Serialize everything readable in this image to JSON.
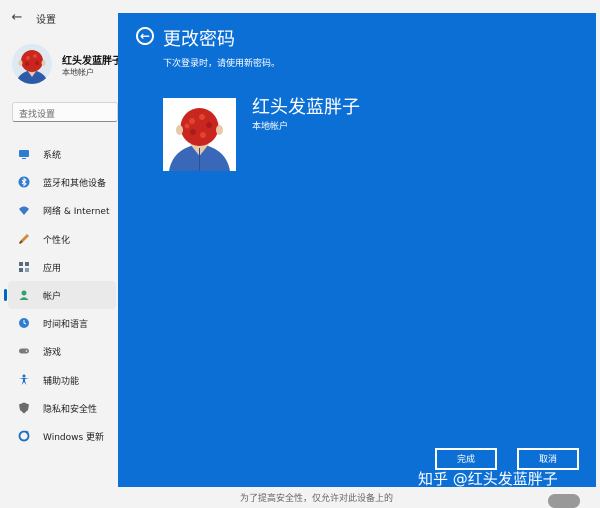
{
  "app": {
    "title": "设置",
    "back_glyph": "←"
  },
  "profile": {
    "name": "红头发蓝胖子",
    "account_type": "本地帐户"
  },
  "search": {
    "placeholder": "查找设置"
  },
  "nav": {
    "items": [
      {
        "label": "系统",
        "icon": "monitor-icon",
        "color": "#2f7dd1"
      },
      {
        "label": "蓝牙和其他设备",
        "icon": "bluetooth-icon",
        "color": "#2f7dd1"
      },
      {
        "label": "网络 & Internet",
        "icon": "wifi-icon",
        "color": "#3b78c8"
      },
      {
        "label": "个性化",
        "icon": "brush-icon",
        "color": "#d08a3a"
      },
      {
        "label": "应用",
        "icon": "apps-icon",
        "color": "#5a6b7c"
      },
      {
        "label": "帐户",
        "icon": "account-icon",
        "color": "#2fa36b"
      },
      {
        "label": "时间和语言",
        "icon": "globe-clock-icon",
        "color": "#2f7dd1"
      },
      {
        "label": "游戏",
        "icon": "gamepad-icon",
        "color": "#7a7a7a"
      },
      {
        "label": "辅助功能",
        "icon": "accessibility-icon",
        "color": "#1d6fc4"
      },
      {
        "label": "隐私和安全性",
        "icon": "shield-icon",
        "color": "#6b6b6b"
      },
      {
        "label": "Windows 更新",
        "icon": "update-icon",
        "color": "#1d6fc4"
      }
    ],
    "selected": "帐户"
  },
  "dialog": {
    "back_glyph": "←",
    "title": "更改密码",
    "subtitle": "下次登录时，请使用新密码。",
    "user_name": "红头发蓝胖子",
    "user_type": "本地帐户",
    "finish_label": "完成",
    "cancel_label": "取消",
    "bg_color": "#0c6fd6"
  },
  "background_text": "为了提高安全性，仅允许对此设备上的",
  "watermark": "知乎 @红头发蓝胖子"
}
